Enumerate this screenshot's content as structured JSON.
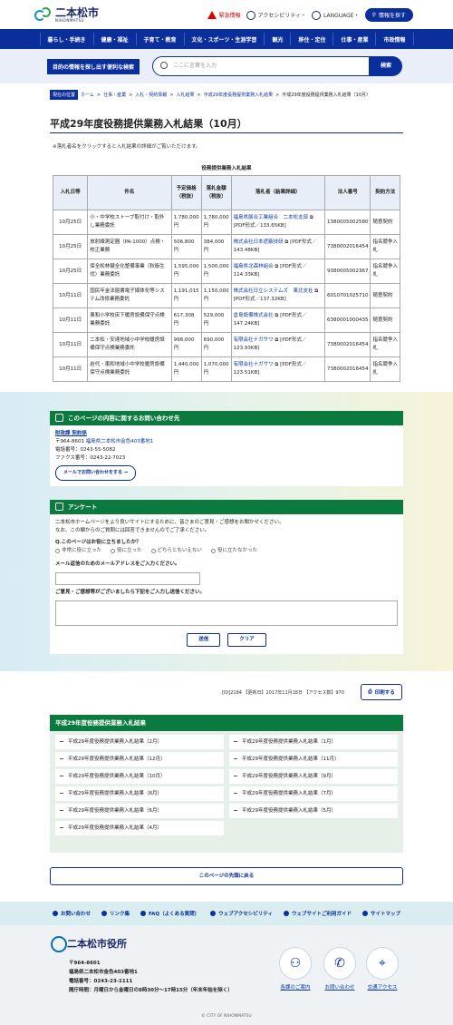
{
  "header": {
    "logo_text": "二本松市",
    "logo_sub": "NIHONMATSU",
    "emergency": "緊急情報",
    "accessibility": "アクセシビリティ・",
    "language": "LANGUAGE・",
    "search_info": "情報を探す"
  },
  "nav": [
    "暮らし・手続き",
    "健康・福祉",
    "子育て・教育",
    "文化・スポーツ・生涯学習",
    "観光",
    "移住・定住",
    "仕事・産業",
    "市政情報"
  ],
  "search": {
    "label": "目的の情報を探し出す便利な検索",
    "placeholder": "ここに言葉を入力",
    "button": "検索"
  },
  "breadcrumb": {
    "here": "現在の位置",
    "items": [
      "ホーム",
      "仕事・産業",
      "入札・契約情報",
      "入札結果",
      "平成29年度役務提供業務入札結果"
    ],
    "current": "平成29年度役務提供業務入札結果（10月）"
  },
  "page_title": "平成29年度役務提供業務入札結果（10月）",
  "note": "※落札者名をクリックすると入札結果の詳細がご覧いただけます。",
  "table": {
    "caption": "役務提供業務入札結果",
    "headers": [
      "入札日等",
      "件名",
      "予定価格（税抜）",
      "落札金額（税抜）",
      "落札者（結果詳細）",
      "法人番号",
      "契約方法"
    ],
    "rows": [
      {
        "date": "10月25日",
        "name": "小・中学校ストーブ取付け・取外し業務委託",
        "plan": "1,780,000円",
        "award": "1,780,000円",
        "winner": "福島県飯合工業組合　二本松支部",
        "file": "[PDF形式／133.65KB]",
        "corp": "1380005002580",
        "method": "随意契約"
      },
      {
        "date": "10月25日",
        "name": "放射線測定器（PA-1000）点検・校正業務",
        "plan": "506,800円",
        "award": "384,000円",
        "winner": "株式会社日本遮蔽技研",
        "file": "[PDF形式／143.48KB]",
        "corp": "7380002016454",
        "method": "指名競争入札"
      },
      {
        "date": "10月25日",
        "name": "保全松林健全化整備事業（秋衛生伐）業務委託",
        "plan": "1,595,000円",
        "award": "1,500,000円",
        "winner": "福島県北森林組合",
        "file": "[PDF形式／114.33KB]",
        "corp": "9380005002367",
        "method": "指名競争入札"
      },
      {
        "date": "10月11日",
        "name": "国民年金法届書電子媒体化等システム改修業務委託",
        "plan": "1,191,015円",
        "award": "1,150,000円",
        "winner": "株式会社日立システムズ　東北支社",
        "file": "[PDF形式／137.32KB]",
        "corp": "6010701025710",
        "method": "随意契約"
      },
      {
        "date": "10月11日",
        "name": "東和小学校床下暖房設備保守点検業務委託",
        "plan": "617,308円",
        "award": "529,000円",
        "winner": "倉島設備株式会社",
        "file": "[PDF形式／147.24KB]",
        "corp": "6380001000435",
        "method": "随意契約"
      },
      {
        "date": "10月11日",
        "name": "二本松・安達地域小中学校暖房設備保守点検業務委託",
        "plan": "998,000円",
        "award": "690,000円",
        "winner": "有限会社ナガサワ",
        "file": "[PDF形式／123.93KB]",
        "corp": "7380002016454",
        "method": "指名競争入札"
      },
      {
        "date": "10月11日",
        "name": "岩代・東和地域小中学校暖房設備保守点検業務委託",
        "plan": "1,440,000円",
        "award": "1,070,000円",
        "winner": "有限会社ナガサワ",
        "file": "[PDF形式／123.51KB]",
        "corp": "7380002016454",
        "method": "指名競争入札"
      }
    ]
  },
  "contact": {
    "title": "このページの内容に関するお問い合わせ先",
    "dept": "財政課 契約係",
    "addr_prefix": "〒964-8601",
    "addr": "福島県二本松市金色403番地1",
    "tel": "電話番号：0243-55-5082",
    "fax": "ファクス番号：0243-22-7023",
    "mail_btn": "メールでお問い合わせをする"
  },
  "survey": {
    "title": "アンケート",
    "intro1": "二本松市ホームページをより良いサイトにするために、皆さまのご意見・ご感想をお聞かせください。",
    "intro2": "なお、この欄からのご質問には回答できませんのでご了承ください。",
    "q1": "Q.このページはお役に立ちましたか？",
    "options": [
      "非常に役に立った",
      "役に立った",
      "どちらともいえない",
      "役に立たなかった"
    ],
    "q2": "メール返信のためのメールアドレスをご入力ください。",
    "q3": "ご意見・ご感想等がございましたら下記をご入力し送信ください。",
    "send": "送信",
    "clear": "クリア"
  },
  "meta": "[ID]2184 【更新日】2017年11月18日 【アクセス数】970",
  "print": "印刷する",
  "related": {
    "title": "平成29年度役務提供業務入札結果",
    "items": [
      "平成29年度役務提供業務入札結果（2月）",
      "平成29年度役務提供業務入札結果（1月）",
      "平成29年度役務提供業務入札結果（12月）",
      "平成29年度役務提供業務入札結果（11月）",
      "平成29年度役務提供業務入札結果（10月）",
      "平成29年度役務提供業務入札結果（9月）",
      "平成29年度役務提供業務入札結果（8月）",
      "平成29年度役務提供業務入札結果（7月）",
      "平成29年度役務提供業務入札結果（6月）",
      "平成29年度役務提供業務入札結果（5月）",
      "平成29年度役務提供業務入札結果（4月）"
    ]
  },
  "totop": "このページの先頭に戻る",
  "footer": {
    "links": [
      "お問い合わせ",
      "リンク集",
      "FAQ（よくある質問）",
      "ウェブアクセシビリティ",
      "ウェブサイトご利用ガイド",
      "サイトマップ"
    ],
    "name": "二本松市役所",
    "postal": "〒964-8601",
    "addr": "福島県二本松市金色403番地1",
    "tel": "電話番号：0243-23-1111",
    "hours": "開庁時間：月曜日から金曜日の8時30分～17時15分（年末年始を除く）",
    "icons": [
      "各課のご案内",
      "お問い合わせ",
      "交通アクセス"
    ],
    "copyright": "© CITY OF NIHONMATSU"
  }
}
